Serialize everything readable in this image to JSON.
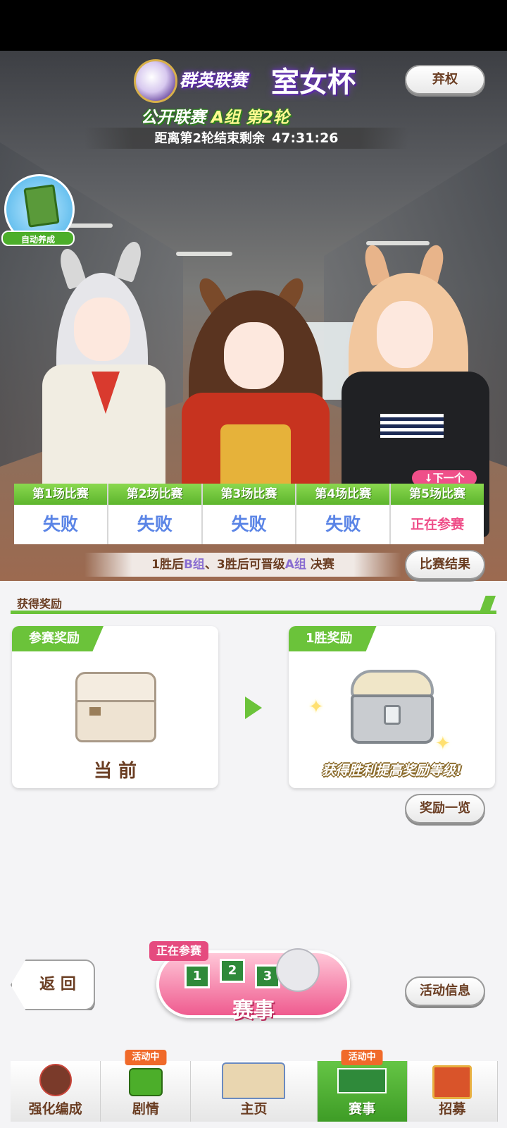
{
  "header": {
    "league_title": "群英联赛",
    "cup_name": "室女杯",
    "round_prefix": "公开联赛",
    "group": "A组",
    "round": "第2轮",
    "countdown_label": "距离第2轮结束剩余",
    "countdown_time": "47:31:26",
    "forfeit_label": "弃权"
  },
  "auto_train": {
    "label": "自动养成"
  },
  "races": {
    "next_badge": "↓下一个",
    "items": [
      {
        "label": "第1场比赛",
        "result": "失败"
      },
      {
        "label": "第2场比赛",
        "result": "失败"
      },
      {
        "label": "第3场比赛",
        "result": "失败"
      },
      {
        "label": "第4场比赛",
        "result": "失败"
      },
      {
        "label": "第5场比赛",
        "result": "正在参赛"
      }
    ],
    "advance_note_a": "1胜后",
    "advance_group_b": "B组",
    "advance_note_b": "、3胜后可晋级",
    "advance_group_a": "A组",
    "advance_note_c": "决赛",
    "results_button": "比赛结果"
  },
  "rewards": {
    "title": "获得奖励",
    "participation": {
      "tag": "参赛奖励",
      "caption": "当 前"
    },
    "win": {
      "tag": "1胜奖励",
      "caption": "获得胜利提高奖励等级!"
    },
    "list_button": "奖励一览"
  },
  "bottom": {
    "back_label": "返 回",
    "event_tag": "正在参赛",
    "event_label": "赛事",
    "gates": [
      "1",
      "2",
      "3"
    ],
    "activity_info_label": "活动信息"
  },
  "nav": {
    "items": [
      {
        "label": "强化编成",
        "badge": ""
      },
      {
        "label": "剧情",
        "badge": "活动中"
      },
      {
        "label": "主页",
        "badge": ""
      },
      {
        "label": "赛事",
        "badge": "活动中"
      },
      {
        "label": "招募",
        "badge": ""
      }
    ],
    "active": "赛事"
  },
  "colors": {
    "accent_green": "#6bc33a",
    "loss_blue": "#5a84e6",
    "current_pink": "#ef4f89",
    "text_brown": "#6a3d22"
  }
}
